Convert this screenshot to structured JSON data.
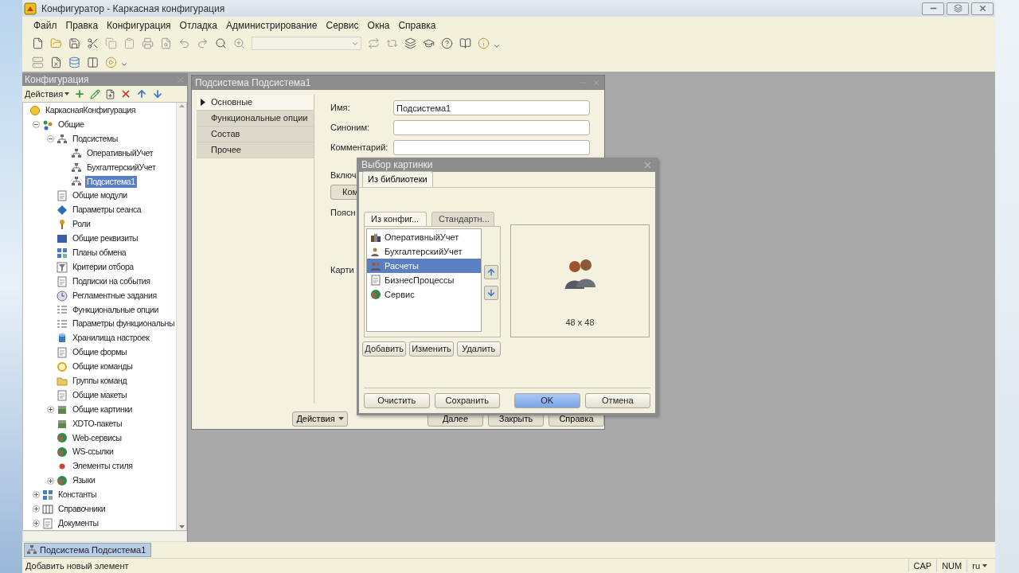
{
  "window": {
    "title": "Конфигуратор - Каркасная конфигурация"
  },
  "menu": [
    "Файл",
    "Правка",
    "Конфигурация",
    "Отладка",
    "Администрирование",
    "Сервис",
    "Окна",
    "Справка"
  ],
  "config_panel": {
    "title": "Конфигурация",
    "actions_button": "Действия",
    "tree": [
      {
        "label": "КаркаснаяКонфигурация",
        "kind": "ball",
        "selected": false,
        "children": [
          {
            "label": "Общие",
            "kind": "nodes",
            "selected": false,
            "expanded": true,
            "children": [
              {
                "label": "Подсистемы",
                "kind": "hierarchy",
                "selected": false,
                "expanded": true,
                "children": [
                  {
                    "label": "ОперативныйУчет",
                    "kind": "hierarchy",
                    "selected": false
                  },
                  {
                    "label": "БухгалтерскийУчет",
                    "kind": "hierarchy",
                    "selected": false
                  },
                  {
                    "label": "Подсистема1",
                    "kind": "hierarchy",
                    "selected": true
                  }
                ]
              },
              {
                "label": "Общие модули",
                "kind": "document",
                "selected": false
              },
              {
                "label": "Параметры сеанса",
                "kind": "diamond",
                "selected": false
              },
              {
                "label": "Роли",
                "kind": "key",
                "selected": false
              },
              {
                "label": "Общие реквизиты",
                "kind": "bar",
                "selected": false
              },
              {
                "label": "Планы обмена",
                "kind": "grid",
                "selected": false
              },
              {
                "label": "Критерии отбора",
                "kind": "funnel",
                "selected": false
              },
              {
                "label": "Подписки на события",
                "kind": "document",
                "selected": false
              },
              {
                "label": "Регламентные задания",
                "kind": "clock",
                "selected": false
              },
              {
                "label": "Функциональные опции",
                "kind": "list",
                "selected": false
              },
              {
                "label": "Параметры функциональны",
                "kind": "list",
                "selected": false
              },
              {
                "label": "Хранилища настроек",
                "kind": "cylinder",
                "selected": false
              },
              {
                "label": "Общие формы",
                "kind": "document",
                "selected": false
              },
              {
                "label": "Общие команды",
                "kind": "ring",
                "selected": false
              },
              {
                "label": "Группы команд",
                "kind": "folder",
                "selected": false
              },
              {
                "label": "Общие макеты",
                "kind": "document",
                "selected": false
              },
              {
                "label": "Общие картинки",
                "kind": "square",
                "selected": false,
                "expanded": false
              },
              {
                "label": "XDTO-пакеты",
                "kind": "square",
                "selected": false
              },
              {
                "label": "Web-сервисы",
                "kind": "globe",
                "selected": false
              },
              {
                "label": "WS-ссылки",
                "kind": "globe",
                "selected": false
              },
              {
                "label": "Элементы стиля",
                "kind": "dot",
                "selected": false
              },
              {
                "label": "Языки",
                "kind": "globe",
                "selected": false,
                "expanded": false
              }
            ]
          },
          {
            "label": "Константы",
            "kind": "grid",
            "selected": false,
            "expanded": false
          },
          {
            "label": "Справочники",
            "kind": "columns",
            "selected": false,
            "expanded": false
          },
          {
            "label": "Документы",
            "kind": "document",
            "selected": false,
            "expanded": false
          }
        ]
      }
    ]
  },
  "subsystem_window": {
    "title": "Подсистема Подсистема1",
    "sections": [
      {
        "label": "Основные",
        "selected": true
      },
      {
        "label": "Функциональные опции",
        "selected": false
      },
      {
        "label": "Состав",
        "selected": false
      },
      {
        "label": "Прочее",
        "selected": false
      }
    ],
    "fields": [
      {
        "label": "Имя:",
        "value": "Подсистема1"
      },
      {
        "label": "Синоним:"
      },
      {
        "label": "Комментарий:"
      }
    ],
    "include_label": "Включ",
    "command_button": "Ком",
    "explanation_label": "Поясн",
    "picture_label": "Карти",
    "bottom_buttons": [
      {
        "label": "Действия",
        "kind": "menu"
      },
      {
        "label": "Далее",
        "kind": "plain"
      },
      {
        "label": "Закрыть",
        "kind": "plain"
      },
      {
        "label": "Справка",
        "kind": "plain"
      }
    ]
  },
  "dialog": {
    "title": "Выбор картинки",
    "tab": "Из библиотеки",
    "source_tabs": [
      {
        "label": "Из конфиг...",
        "selected": true
      },
      {
        "label": "Стандартн...",
        "selected": false
      }
    ],
    "items": [
      {
        "label": "ОперативныйУчет",
        "kind": "stack",
        "selected": false
      },
      {
        "label": "БухгалтерскийУчет",
        "kind": "person",
        "selected": false
      },
      {
        "label": "Расчеты",
        "kind": "people",
        "selected": true
      },
      {
        "label": "БизнесПроцессы",
        "kind": "document",
        "selected": false
      },
      {
        "label": "Сервис",
        "kind": "globe",
        "selected": false
      }
    ],
    "preview_size": "48 x 48",
    "list_buttons": [
      "Добавить",
      "Изменить",
      "Удалить"
    ],
    "buttons": [
      {
        "label": "Очистить",
        "default": false
      },
      {
        "label": "Сохранить",
        "default": false
      },
      {
        "label": "OK",
        "default": true
      },
      {
        "label": "Отмена",
        "default": false
      }
    ]
  },
  "taskbar": [
    {
      "label": "Подсистема Подсистема1",
      "selected": true
    }
  ],
  "status_bar": {
    "message": "Добавить новый элемент",
    "indicators": [
      "CAP",
      "NUM"
    ],
    "language": "ru"
  }
}
